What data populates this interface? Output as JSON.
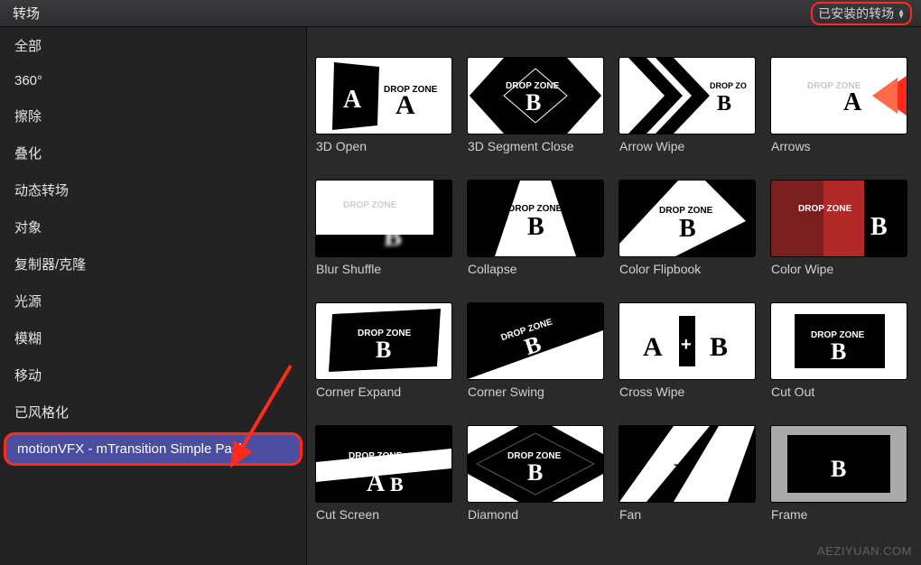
{
  "topbar": {
    "title": "转场",
    "filter_label": "已安装的转场"
  },
  "sidebar": {
    "items": [
      {
        "label": "全部"
      },
      {
        "label": "360°"
      },
      {
        "label": "擦除"
      },
      {
        "label": "叠化"
      },
      {
        "label": "动态转场"
      },
      {
        "label": "对象"
      },
      {
        "label": "复制器/克隆"
      },
      {
        "label": "光源"
      },
      {
        "label": "模糊"
      },
      {
        "label": "移动"
      },
      {
        "label": "已风格化"
      },
      {
        "label": "motionVFX - mTransition Simple Pack",
        "selected": true
      }
    ]
  },
  "grid": {
    "dropzone_text": "DROP ZONE",
    "tiles": [
      {
        "label": "3D Open"
      },
      {
        "label": "3D Segment Close"
      },
      {
        "label": "Arrow Wipe"
      },
      {
        "label": "Arrows"
      },
      {
        "label": "Blur Shuffle"
      },
      {
        "label": "Collapse"
      },
      {
        "label": "Color Flipbook"
      },
      {
        "label": "Color Wipe"
      },
      {
        "label": "Corner Expand"
      },
      {
        "label": "Corner Swing"
      },
      {
        "label": "Cross Wipe"
      },
      {
        "label": "Cut Out"
      },
      {
        "label": "Cut Screen"
      },
      {
        "label": "Diamond"
      },
      {
        "label": "Fan"
      },
      {
        "label": "Frame"
      }
    ]
  },
  "watermark": "AEZIYUAN.COM"
}
